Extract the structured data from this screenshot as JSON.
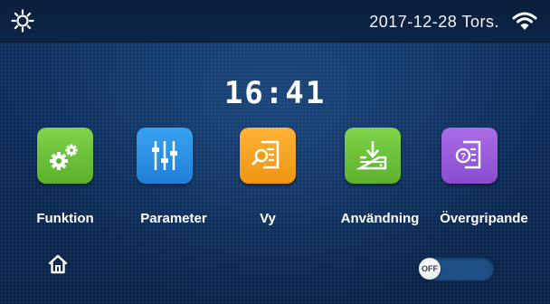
{
  "header": {
    "datetime": "2017-12-28 Tors.",
    "left_icon": "sun-settings-icon",
    "right_icon": "wifi-icon"
  },
  "clock": {
    "time": "16:41"
  },
  "tiles": [
    {
      "label": "Funktion",
      "icon": "gears-icon",
      "color": "#6cc23a"
    },
    {
      "label": "Parameter",
      "icon": "sliders-icon",
      "color": "#2a8fe6"
    },
    {
      "label": "Vy",
      "icon": "view-document-icon",
      "color": "#f5a21c"
    },
    {
      "label": "Användning",
      "icon": "download-tray-icon",
      "color": "#6cc23a"
    },
    {
      "label": "Övergripande",
      "icon": "help-document-icon",
      "color": "#9a5bdc"
    }
  ],
  "footer": {
    "home_icon": "home-icon",
    "toggle_label": "OFF"
  },
  "colors": {
    "background": "#0d2b55",
    "topbar": "#0a1f3c",
    "text": "#ffffff"
  }
}
